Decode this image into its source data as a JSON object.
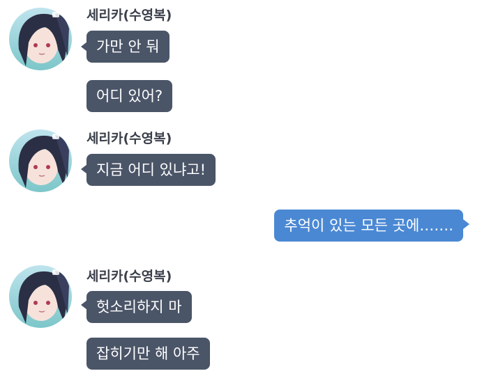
{
  "messages": [
    {
      "sender": "세리카(수영복)",
      "lines": [
        "가만 안 둬",
        "어디 있어?"
      ]
    },
    {
      "sender": "세리카(수영복)",
      "lines": [
        "지금 어디 있냐고!"
      ]
    },
    {
      "outgoing": "추억이 있는 모든 곳에……."
    },
    {
      "sender": "세리카(수영복)",
      "lines": [
        "헛소리하지 마",
        "잡히기만 해 아주"
      ]
    }
  ],
  "colors": {
    "incoming_bubble": "#4b5568",
    "outgoing_bubble": "#4a88d3",
    "sender_text": "#3a3f4a"
  },
  "icons": {
    "avatar": "character-portrait"
  }
}
